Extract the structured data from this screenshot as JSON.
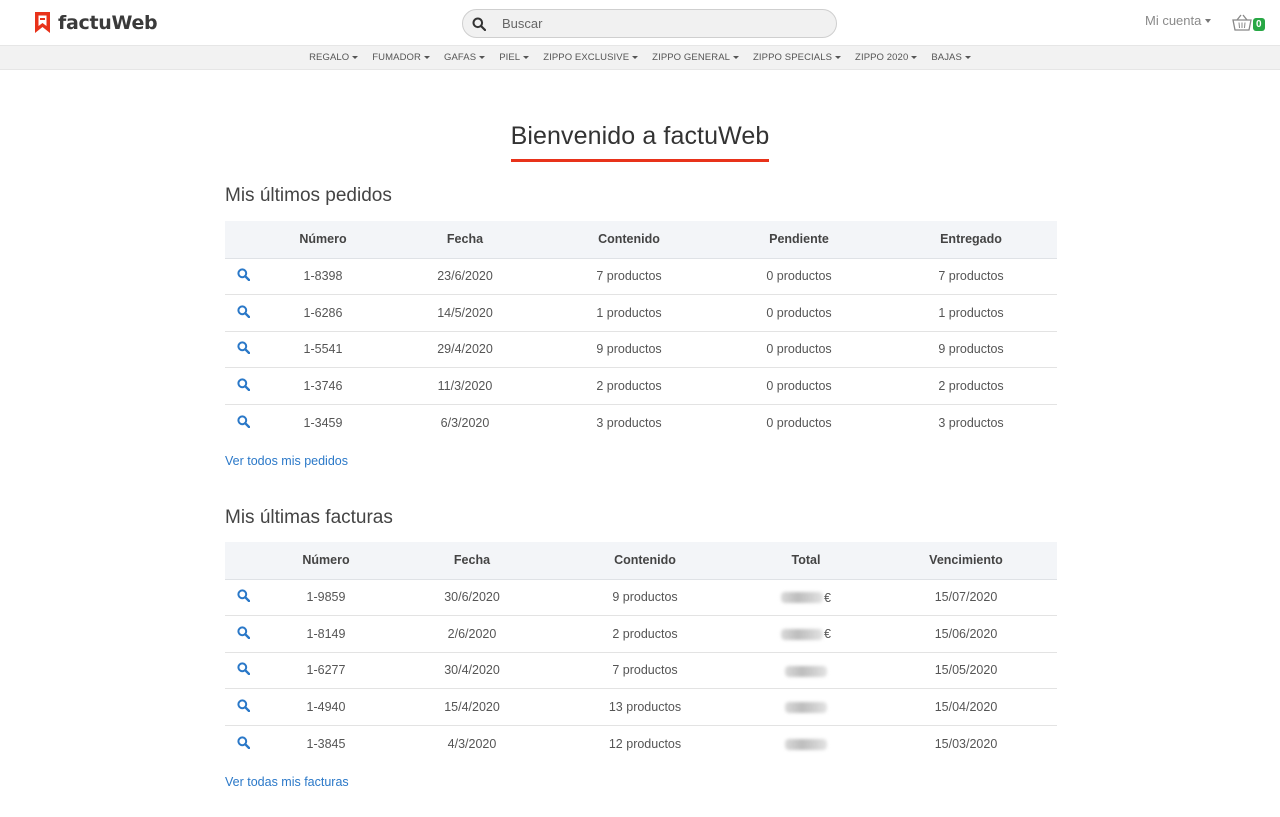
{
  "brand": {
    "name": "factuWeb",
    "accent": "#e8321a"
  },
  "search": {
    "placeholder": "Buscar"
  },
  "account": {
    "label": "Mi cuenta"
  },
  "cart": {
    "count": "0",
    "badge_color": "#28a745"
  },
  "nav": [
    "REGALO",
    "FUMADOR",
    "GAFAS",
    "PIEL",
    "ZIPPO EXCLUSIVE",
    "ZIPPO GENERAL",
    "ZIPPO SPECIALS",
    "ZIPPO 2020",
    "BAJAS"
  ],
  "welcome": {
    "title": "Bienvenido a factuWeb"
  },
  "orders": {
    "title": "Mis últimos pedidos",
    "headers": [
      "Número",
      "Fecha",
      "Contenido",
      "Pendiente",
      "Entregado"
    ],
    "rows": [
      [
        "1-8398",
        "23/6/2020",
        "7 productos",
        "0 productos",
        "7 productos"
      ],
      [
        "1-6286",
        "14/5/2020",
        "1 productos",
        "0 productos",
        "1 productos"
      ],
      [
        "1-5541",
        "29/4/2020",
        "9 productos",
        "0 productos",
        "9 productos"
      ],
      [
        "1-3746",
        "11/3/2020",
        "2 productos",
        "0 productos",
        "2 productos"
      ],
      [
        "1-3459",
        "6/3/2020",
        "3 productos",
        "0 productos",
        "3 productos"
      ]
    ],
    "link": "Ver todos mis pedidos"
  },
  "invoices": {
    "title": "Mis últimas facturas",
    "headers": [
      "Número",
      "Fecha",
      "Contenido",
      "Total",
      "Vencimiento"
    ],
    "rows": [
      [
        "1-9859",
        "30/6/2020",
        "9 productos",
        "€",
        "15/07/2020"
      ],
      [
        "1-8149",
        "2/6/2020",
        "2 productos",
        "€",
        "15/06/2020"
      ],
      [
        "1-6277",
        "30/4/2020",
        "7 productos",
        "",
        "15/05/2020"
      ],
      [
        "1-4940",
        "15/4/2020",
        "13 productos",
        "",
        "15/04/2020"
      ],
      [
        "1-3845",
        "4/3/2020",
        "12 productos",
        "",
        "15/03/2020"
      ]
    ],
    "link": "Ver todas mis facturas"
  }
}
